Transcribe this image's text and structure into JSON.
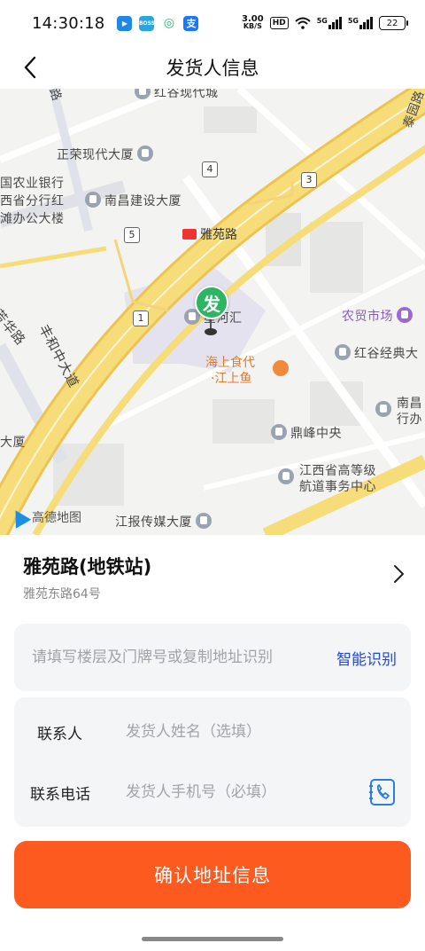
{
  "status_bar": {
    "time": "14:30:18",
    "speed_top": "3.00",
    "speed_unit": "KB/S",
    "hd": "HD",
    "sig1": "5G",
    "sig2": "5G",
    "battery": "22",
    "apps": [
      {
        "name": "app-icon-1",
        "color": "#1e88e5",
        "label": "▶"
      },
      {
        "name": "app-icon-boss",
        "color": "#2aa6df",
        "label": "BOSS"
      },
      {
        "name": "app-icon-3",
        "color": "#2bb673",
        "label": "◎"
      },
      {
        "name": "alipay-icon",
        "color": "#1677ff",
        "label": "支"
      }
    ]
  },
  "nav": {
    "title": "发货人信息"
  },
  "map": {
    "labels": {
      "l1": "红谷现代城",
      "l2": "正荣现代大厦",
      "l3": "国农业银行",
      "l4": "西省分行红",
      "l5": "滩办公大楼",
      "l6": "南昌建设大厦",
      "l7": "雅苑路",
      "l8": "丰和中大道",
      "l9": "芳华路",
      "l10": "星河汇",
      "l11": "海上食代",
      "l12": "·江上鱼",
      "l13": "农贸市场",
      "l14": "红谷经典大",
      "l15": "南昌",
      "l16": "行办",
      "l17": "鼎峰中央",
      "l18": "江西省高等级",
      "l19": "航道事务中心",
      "l20": "大厦",
      "l21": "江报传媒大厦",
      "l22": "高德地图",
      "l23": "路",
      "l24": "泰园路"
    },
    "route_badges": [
      "4",
      "3",
      "5",
      "1"
    ],
    "pin_label": "发",
    "colors": {
      "road_main": "#f7dc7a",
      "road_border": "#ecc452",
      "pin": "#2eb463"
    }
  },
  "place": {
    "name": "雅苑路(地铁站)",
    "address": "雅苑东路64号"
  },
  "detail": {
    "placeholder": "请填写楼层及门牌号或复制地址识别",
    "smart_label": "智能识别"
  },
  "contact": {
    "name_label": "联系人",
    "name_placeholder": "发货人姓名（选填）",
    "phone_label": "联系电话",
    "phone_placeholder": "发货人手机号（必填）"
  },
  "confirm": {
    "label": "确认地址信息",
    "color": "#fc5a1f"
  }
}
